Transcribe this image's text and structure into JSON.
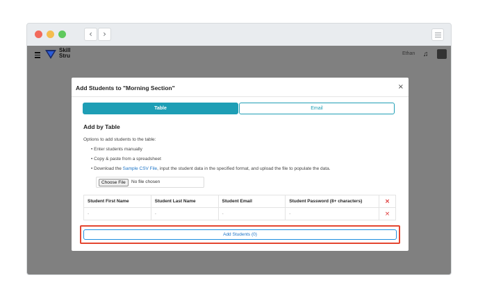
{
  "browser": {
    "back_icon": "‹",
    "forward_icon": "›"
  },
  "appbar": {
    "logo_text_line1": "Skill",
    "logo_text_line2": "Stru",
    "user_name": "Ethan"
  },
  "modal": {
    "title": "Add Students to \"Morning Section\"",
    "close": "×",
    "tabs": [
      "Table",
      "Email"
    ],
    "section_title": "Add by Table",
    "intro": "Options to add students to the table:",
    "bullets": {
      "manual": "Enter students manually",
      "paste": "Copy & paste from a spreadsheet",
      "download_prefix": "Download the ",
      "download_link": "Sample CSV File",
      "download_suffix": ", input the student data in the specified format, and upload the file to populate the data."
    },
    "file": {
      "button": "Choose File",
      "status": "No file chosen"
    },
    "table": {
      "headers": [
        "Student First Name",
        "Student Last Name",
        "Student Email",
        "Student Password (8+ characters)"
      ],
      "row": [
        "-",
        "-",
        "-",
        "-"
      ],
      "delete_icon": "×"
    },
    "add_button": "Add Students (0)"
  },
  "colors": {
    "accent": "#1e9eb5",
    "link": "#1a73c7",
    "highlight": "#e4452f",
    "overlay": "#808080"
  }
}
